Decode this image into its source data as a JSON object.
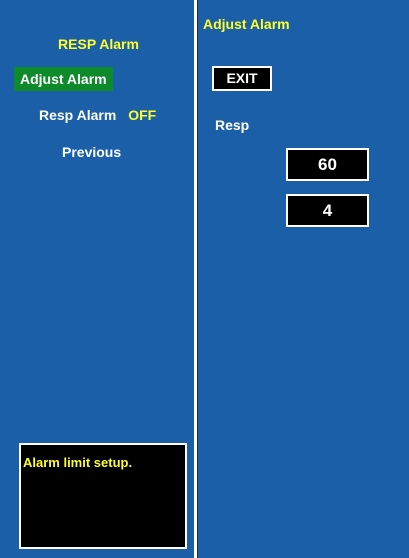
{
  "menu": {
    "title": "RESP Alarm",
    "items": [
      {
        "label": "Adjust Alarm"
      },
      {
        "label": "Resp Alarm",
        "value": "OFF"
      },
      {
        "label": "Previous"
      }
    ]
  },
  "help": {
    "text": "Alarm limit setup."
  },
  "panel": {
    "title": "Adjust Alarm",
    "exit_label": "EXIT",
    "resp_label": "Resp",
    "high_limit": "60",
    "low_limit": "4"
  },
  "colors": {
    "background": "#1b5fa8",
    "selected": "#0d8a2a",
    "highlight_text": "#ffff2a"
  }
}
